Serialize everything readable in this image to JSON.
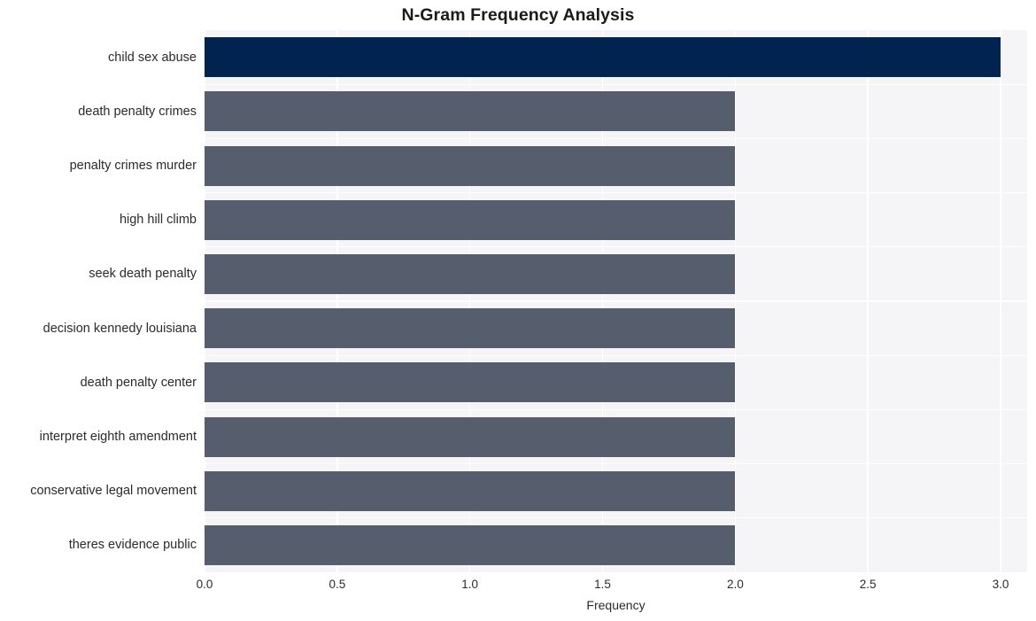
{
  "chart_data": {
    "type": "bar",
    "orientation": "horizontal",
    "title": "N-Gram Frequency Analysis",
    "xlabel": "Frequency",
    "ylabel": "",
    "xlim": [
      0.0,
      3.1
    ],
    "xticks": [
      "0.0",
      "0.5",
      "1.0",
      "1.5",
      "2.0",
      "2.5",
      "3.0"
    ],
    "xtick_values": [
      0.0,
      0.5,
      1.0,
      1.5,
      2.0,
      2.5,
      3.0
    ],
    "grid": true,
    "legend": "none",
    "categories": [
      "child sex abuse",
      "death penalty crimes",
      "penalty crimes murder",
      "high hill climb",
      "seek death penalty",
      "decision kennedy louisiana",
      "death penalty center",
      "interpret eighth amendment",
      "conservative legal movement",
      "theres evidence public"
    ],
    "values": [
      3,
      2,
      2,
      2,
      2,
      2,
      2,
      2,
      2,
      2
    ],
    "bar_colors": [
      "#00234f",
      "#565d6d",
      "#565d6d",
      "#565d6d",
      "#565d6d",
      "#565d6d",
      "#565d6d",
      "#565d6d",
      "#565d6d",
      "#565d6d"
    ],
    "highlight_color": "#00234f",
    "default_bar_color": "#565d6d",
    "plot_background": "#f5f5f7",
    "grid_color": "#ffffff",
    "figure_background": "#ffffff",
    "text_color": "#2b2b2b"
  }
}
